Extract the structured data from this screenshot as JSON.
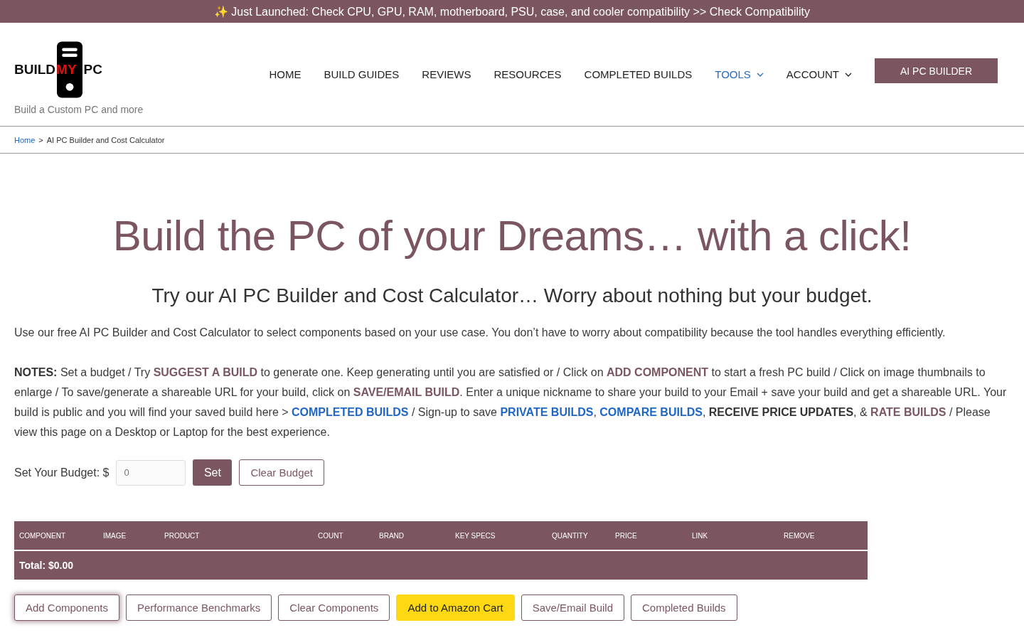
{
  "announcement": {
    "icon": "✨",
    "text": "Just Launched: Check CPU, GPU, RAM, motherboard, PSU, case, and cooler compatibility >> Check Compatibility"
  },
  "logo": {
    "parts": [
      "BUILD",
      "MY",
      "PC"
    ],
    "tagline": "Build a Custom PC and more"
  },
  "nav": [
    {
      "label": "HOME",
      "selected": false,
      "dropdown": false
    },
    {
      "label": "BUILD GUIDES",
      "selected": false,
      "dropdown": false
    },
    {
      "label": "REVIEWS",
      "selected": false,
      "dropdown": false
    },
    {
      "label": "RESOURCES",
      "selected": false,
      "dropdown": false
    },
    {
      "label": "COMPLETED BUILDS",
      "selected": false,
      "dropdown": false
    },
    {
      "label": "TOOLS",
      "selected": true,
      "dropdown": true
    },
    {
      "label": "ACCOUNT",
      "selected": false,
      "dropdown": true
    }
  ],
  "cta_button": "AI PC BUILDER",
  "breadcrumb": {
    "home": "Home",
    "separator": ">",
    "current": "AI PC Builder and Cost Calculator"
  },
  "heading": "Build the PC of your Dreams… with a click!",
  "subheading": "Try our AI PC Builder and Cost Calculator… Worry about nothing but your budget.",
  "intro": "Use our free AI PC Builder and Cost Calculator to select components based on your use case. You don’t have to worry about compatibility because the tool handles everything efficiently.",
  "notes": [
    {
      "kind": "strong",
      "text": "NOTES:"
    },
    {
      "kind": "plain",
      "text": " Set a budget / Try "
    },
    {
      "kind": "brand",
      "text": "SUGGEST A BUILD"
    },
    {
      "kind": "plain",
      "text": " to generate one. Keep generating until you are satisfied or / Click on "
    },
    {
      "kind": "brand",
      "text": "ADD COMPONENT"
    },
    {
      "kind": "plain",
      "text": " to start a fresh PC build / Click on image thumbnails to enlarge / To save/generate a shareable URL for your build, click on "
    },
    {
      "kind": "brand",
      "text": "SAVE/EMAIL BUILD"
    },
    {
      "kind": "plain",
      "text": ". Enter a unique nickname to share your build to your Email + save your build and get a shareable URL. Your build is public and you will find your saved build here > "
    },
    {
      "kind": "link",
      "text": "COMPLETED BUILDS"
    },
    {
      "kind": "plain",
      "text": " / Sign-up to save "
    },
    {
      "kind": "link",
      "text": "PRIVATE BUILDS"
    },
    {
      "kind": "plain",
      "text": ", "
    },
    {
      "kind": "link",
      "text": "COMPARE BUILDS"
    },
    {
      "kind": "plain",
      "text": ", "
    },
    {
      "kind": "strong",
      "text": "RECEIVE PRICE UPDATES"
    },
    {
      "kind": "plain",
      "text": ", & "
    },
    {
      "kind": "brand",
      "text": "RATE BUILDS"
    },
    {
      "kind": "plain",
      "text": " / Please view this page on a Desktop or Laptop for the best experience."
    }
  ],
  "budget": {
    "label": "Set Your Budget: $",
    "placeholder": "0",
    "set_button": "Set",
    "clear_button": "Clear Budget"
  },
  "table": {
    "columns": [
      "COMPONENT",
      "IMAGE",
      "PRODUCT",
      "COUNT",
      "BRAND",
      "KEY SPECS",
      "QUANTITY",
      "PRICE",
      "LINK",
      "REMOVE"
    ],
    "total": "Total: $0.00"
  },
  "actions": [
    {
      "label": "Add Components",
      "kind": "focused"
    },
    {
      "label": "Performance Benchmarks",
      "kind": "outline"
    },
    {
      "label": "Clear Components",
      "kind": "outline"
    },
    {
      "label": "Add to Amazon Cart",
      "kind": "amazon"
    },
    {
      "label": "Save/Email Build",
      "kind": "outline"
    },
    {
      "label": "Completed Builds",
      "kind": "outline"
    }
  ]
}
